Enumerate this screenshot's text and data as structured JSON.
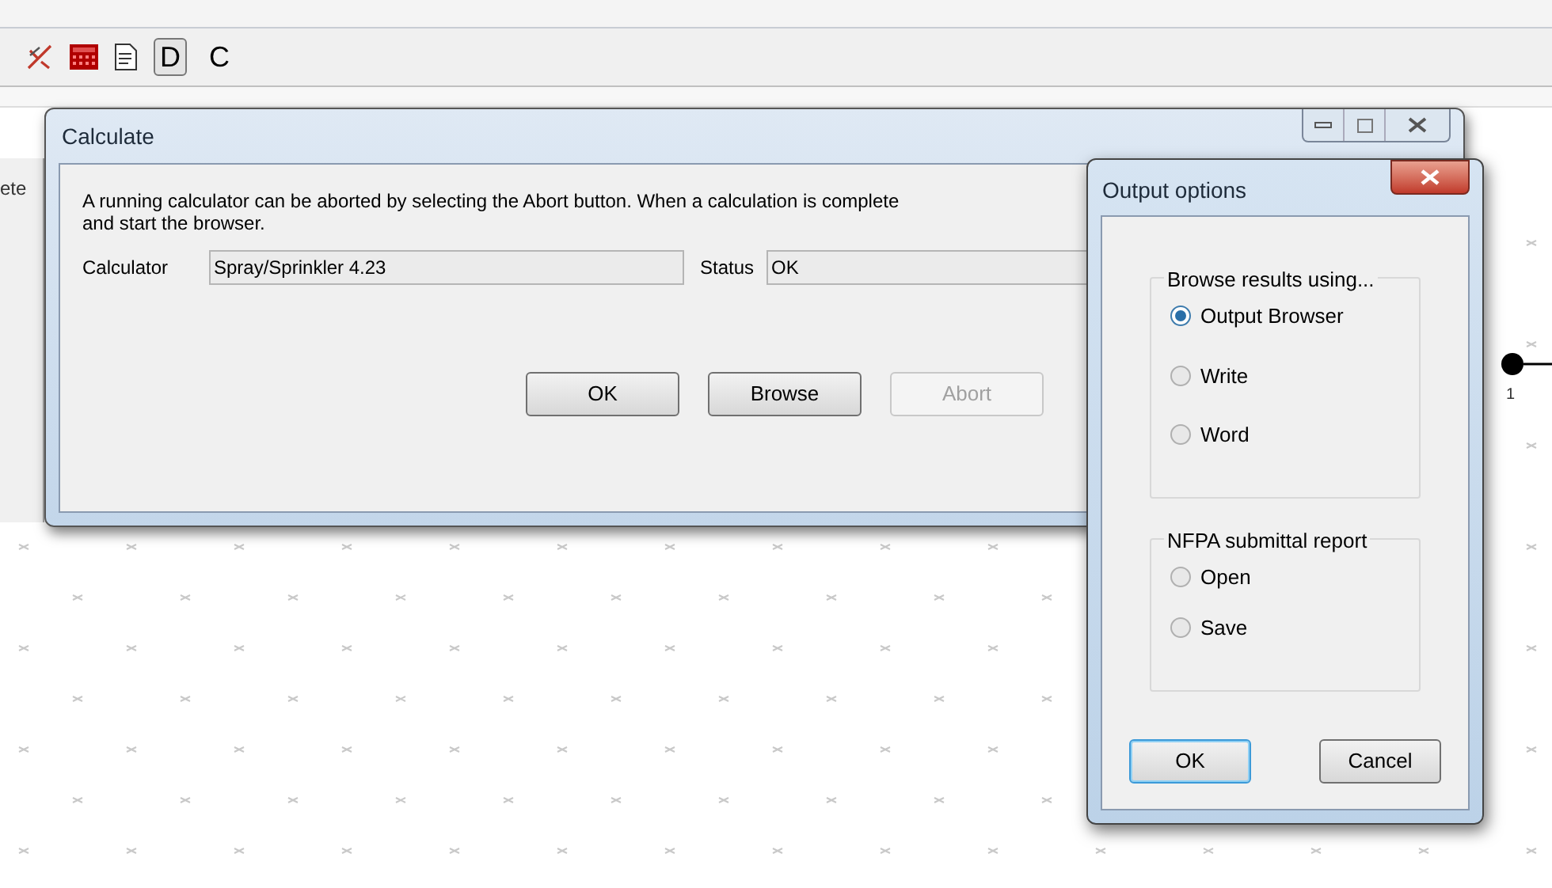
{
  "toolbar": {
    "buttons": [
      {
        "kind": "crossing"
      },
      {
        "kind": "calculator"
      },
      {
        "kind": "document"
      },
      {
        "kind": "text",
        "label": "D",
        "selected": true
      },
      {
        "kind": "text",
        "label": "C",
        "selected": false
      }
    ]
  },
  "side_label": "ete",
  "node_label": "1",
  "calculate_dialog": {
    "title": "Calculate",
    "message_lines": [
      "A running calculator can be aborted by selecting the Abort button. When a calculation is complete",
      "and start the browser."
    ],
    "fields": [
      {
        "label": "Calculator",
        "value": "Spray/Sprinkler 4.23"
      },
      {
        "label": "Status",
        "value": "OK"
      }
    ],
    "buttons": [
      {
        "label": "OK",
        "disabled": false
      },
      {
        "label": "Browse",
        "disabled": false
      },
      {
        "label": "Abort",
        "disabled": true
      }
    ]
  },
  "output_dialog": {
    "title": "Output options",
    "groups": [
      {
        "title": "Browse results using...",
        "options": [
          {
            "label": "Output Browser",
            "selected": true
          },
          {
            "label": "Write",
            "selected": false
          },
          {
            "label": "Word",
            "selected": false
          }
        ]
      },
      {
        "title": "NFPA submittal report",
        "options": [
          {
            "label": "Open",
            "selected": false
          },
          {
            "label": "Save",
            "selected": false
          }
        ]
      }
    ],
    "buttons": [
      {
        "label": "OK",
        "default": true
      },
      {
        "label": "Cancel",
        "default": false
      }
    ]
  }
}
